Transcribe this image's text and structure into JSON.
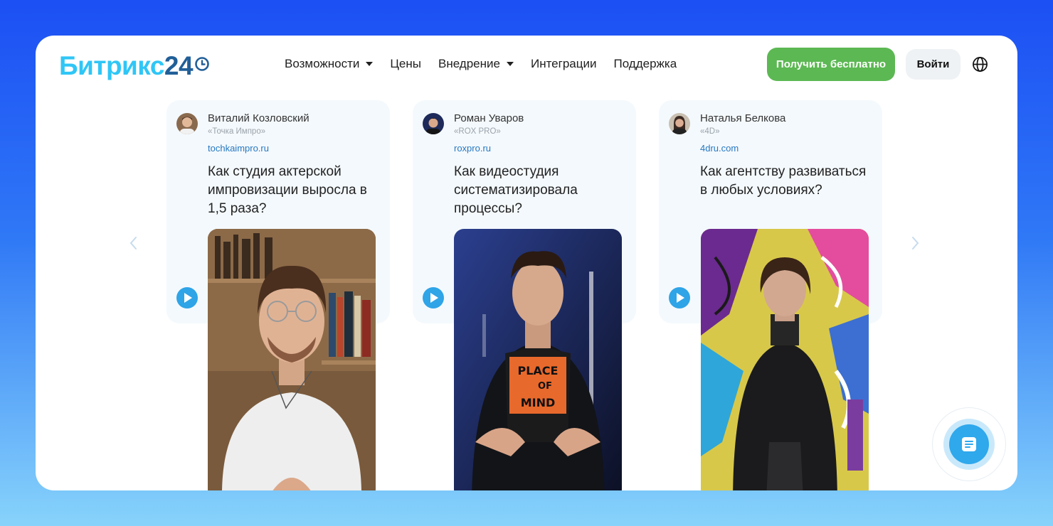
{
  "logo": {
    "brand": "Битрикс",
    "num": "24"
  },
  "nav": [
    {
      "label": "Возможности",
      "dropdown": true
    },
    {
      "label": "Цены",
      "dropdown": false
    },
    {
      "label": "Внедрение",
      "dropdown": true
    },
    {
      "label": "Интеграции",
      "dropdown": false
    },
    {
      "label": "Поддержка",
      "dropdown": false
    }
  ],
  "header": {
    "free_button": "Получить бесплатно",
    "login_button": "Войти",
    "language_icon": "globe-icon"
  },
  "cards": [
    {
      "name": "Виталий Козловский",
      "company": "«Точка Импро»",
      "site": "tochkaimpro.ru",
      "question": "Как студия актерской импровизации выросла в 1,5 раза?"
    },
    {
      "name": "Роман Уваров",
      "company": "«ROX PRO»",
      "site": "roxpro.ru",
      "question": "Как видеостудия систематизировала процессы?"
    },
    {
      "name": "Наталья Белкова",
      "company": "«4D»",
      "site": "4dru.com",
      "question": "Как агентству развиваться в любых условиях?"
    }
  ],
  "colors": {
    "accent": "#2fc6f6",
    "brand_dark": "#215f98",
    "green": "#5cb853",
    "link": "#2678c0"
  },
  "icons": [
    "clock-icon",
    "chevron-down-icon",
    "globe-icon",
    "chevron-left-icon",
    "chevron-right-icon",
    "play-icon",
    "chat-icon"
  ]
}
